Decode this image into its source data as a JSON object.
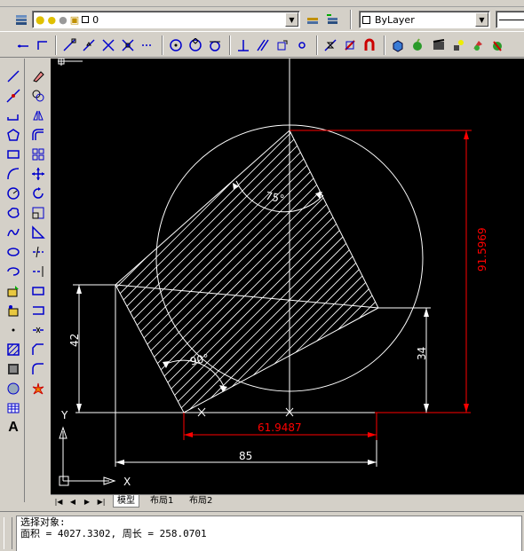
{
  "layer_bar": {
    "current_layer": "0",
    "color_combo": "ByLayer"
  },
  "drawing": {
    "annotations": {
      "angle_top": "75°",
      "angle_bottom": "90°",
      "dim_left": "42",
      "dim_right": "34",
      "dim_bottom_red": "61.9487",
      "dim_bottom_white": "85",
      "dim_vertical_red": "91.5969"
    },
    "ucs": {
      "y_label": "Y",
      "x_label": "X"
    }
  },
  "tabs": {
    "model": "模型",
    "layout1": "布局1",
    "layout2": "布局2"
  },
  "command": {
    "line1": "选择对象:",
    "line2": "面积 = 4027.3302, 周长 = 258.0701"
  },
  "colors": {
    "dim_red": "#ff0000",
    "line_white": "#ffffff",
    "canvas_bg": "#000000"
  }
}
